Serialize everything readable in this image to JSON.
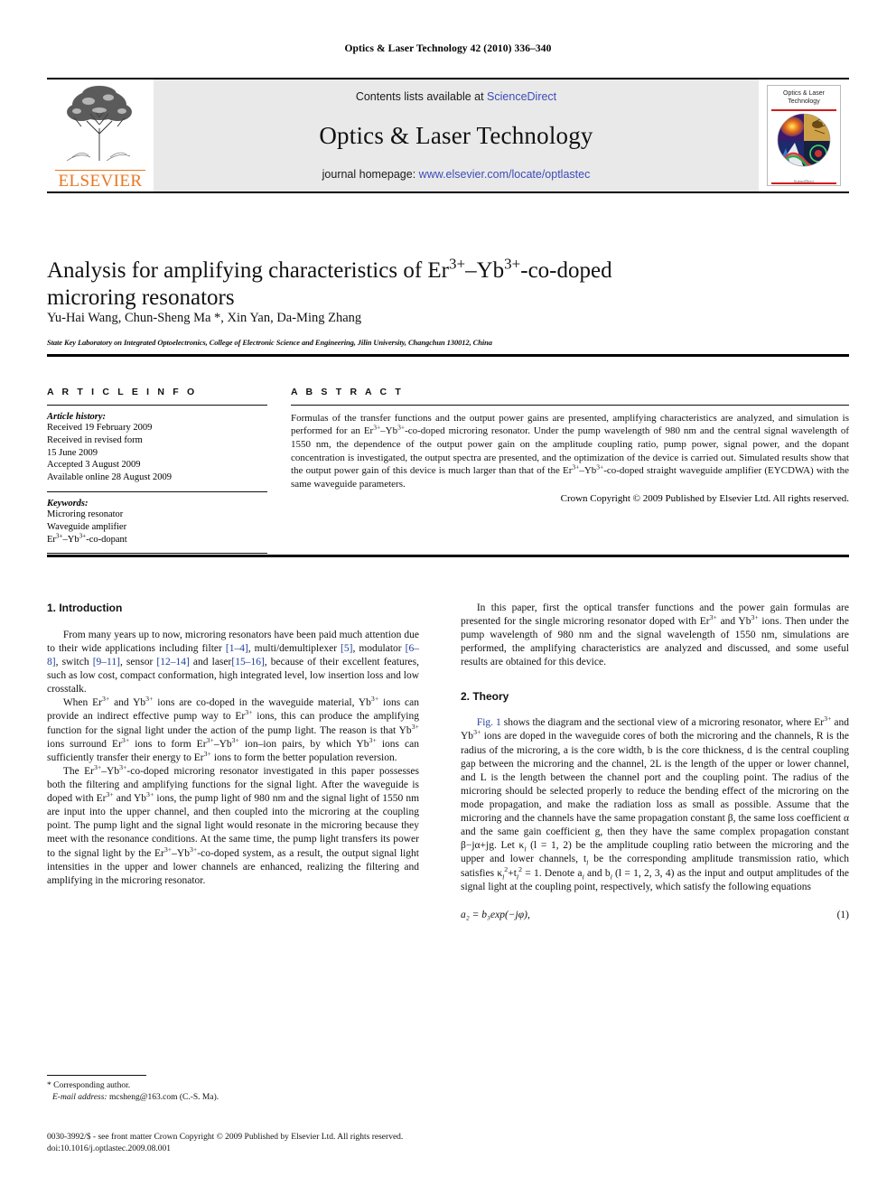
{
  "running_head": "Optics & Laser Technology 42 (2010) 336–340",
  "masthead": {
    "publisher": "ELSEVIER",
    "contents_prefix": "Contents lists available at ",
    "contents_link": "ScienceDirect",
    "journal_title": "Optics & Laser Technology",
    "homepage_prefix": "journal homepage: ",
    "homepage_url": "www.elsevier.com/locate/optlastec",
    "cover_title": "Optics & Laser Technology",
    "cover_footer": "ScienceDirect"
  },
  "article": {
    "title_line1_a": "Analysis for amplifying characteristics of Er",
    "title_sup1": "3+",
    "title_line1_b": "–Yb",
    "title_sup2": "3+",
    "title_line1_c": "-co-doped",
    "title_line2": "microring resonators",
    "authors": "Yu-Hai Wang, Chun-Sheng Ma *, Xin Yan, Da-Ming Zhang",
    "affiliation": "State Key Laboratory on Integrated Optoelectronics, College of Electronic Science and Engineering, Jilin University, Changchun 130012, China"
  },
  "article_info": {
    "heading": "A R T I C L E   I N F O",
    "history_label": "Article history:",
    "history": [
      "Received 19 February 2009",
      "Received in revised form",
      "15 June 2009",
      "Accepted 3 August 2009",
      "Available online 28 August 2009"
    ],
    "keywords_label": "Keywords:",
    "keywords": [
      "Microring resonator",
      "Waveguide amplifier"
    ],
    "keyword_codoped_a": "Er",
    "keyword_codoped_sup1": "3+",
    "keyword_codoped_b": "–Yb",
    "keyword_codoped_sup2": "3+",
    "keyword_codoped_c": "-co-dopant"
  },
  "abstract": {
    "heading": "A B S T R A C T",
    "p1": "Formulas of the transfer functions and the output power gains are presented, amplifying characteristics are analyzed, and simulation is performed for an Er",
    "p2": "–Yb",
    "p3": "-co-doped microring resonator. Under the pump wavelength of 980 nm and the central signal wavelength of 1550 nm, the dependence of the output power gain on the amplitude coupling ratio, pump power, signal power, and the dopant concentration is investigated, the output spectra are presented, and the optimization of the device is carried out. Simulated results show that the output power gain of this device is much larger than that of the Er",
    "p4": "–Yb",
    "p5": "-co-doped straight waveguide amplifier (EYCDWA) with the same waveguide parameters.",
    "sup": "3+",
    "copyright": "Crown Copyright © 2009 Published by Elsevier Ltd. All rights reserved."
  },
  "body": {
    "intro_heading": "1. Introduction",
    "intro_p1_a": "From many years up to now, microring resonators have been paid much attention due to their wide applications including filter ",
    "intro_ref1": "[1–4]",
    "intro_p1_b": ", multi/demultiplexer ",
    "intro_ref2": "[5]",
    "intro_p1_c": ", modulator ",
    "intro_ref3": "[6–8]",
    "intro_p1_d": ", switch ",
    "intro_ref4": "[9–11]",
    "intro_p1_e": ", sensor ",
    "intro_ref5": "[12–14]",
    "intro_p1_f": " and laser",
    "intro_ref6": "[15–16]",
    "intro_p1_g": ", because of their excellent features, such as low cost, compact conformation, high integrated level, low insertion loss and low crosstalk.",
    "intro_p2_a": "When Er",
    "intro_p2_b": " and Yb",
    "intro_p2_c": " ions are co-doped in the waveguide material, Yb",
    "intro_p2_d": " ions can provide an indirect effective pump way to Er",
    "intro_p2_e": " ions, this can produce the amplifying function for the signal light under the action of the pump light. The reason is that Yb",
    "intro_p2_f": " ions surround Er",
    "intro_p2_g": " ions to form Er",
    "intro_p2_h": "–Yb",
    "intro_p2_i": " ion–ion pairs, by which Yb",
    "intro_p2_j": " ions can sufficiently transfer their energy to Er",
    "intro_p2_k": " ions to form the better population reversion.",
    "intro_p3_a": "The Er",
    "intro_p3_b": "–Yb",
    "intro_p3_c": "-co-doped microring resonator investigated in this paper possesses both the filtering and amplifying functions for the signal light. After the waveguide is doped with Er",
    "intro_p3_d": " and Yb",
    "intro_p3_e": " ions, the pump light of 980 nm and the signal light of 1550 nm are input into the upper channel, and then coupled into the microring at the coupling point. The pump light and the signal light would resonate in the microring because they meet with the resonance conditions. At the same time, the pump light transfers its power to the signal light by the Er",
    "intro_p3_f": "–Yb",
    "intro_p3_g": "-co-doped system, as a result, the output signal light intensities in the upper and lower channels are enhanced, realizing the filtering and amplifying in the microring resonator.",
    "right_p1_a": "In this paper, first the optical transfer functions and the power gain formulas are presented for the single microring resonator doped with Er",
    "right_p1_b": " and Yb",
    "right_p1_c": " ions. Then under the pump wavelength of 980 nm and the signal wavelength of 1550 nm, simulations are performed, the amplifying characteristics are analyzed and discussed, and some useful results are obtained for this device.",
    "theory_heading": "2. Theory",
    "theory_fig_ref": "Fig. 1",
    "theory_p1_a": " shows the diagram and the sectional view of a microring resonator, where Er",
    "theory_p1_b": " and Yb",
    "theory_p1_c": " ions are doped in the waveguide cores of both the microring and the channels, R is the radius of the microring, a is the core width, b is the core thickness, d is the central coupling gap between the microring and the channel, 2L is the length of the upper or lower channel, and L is the length between the channel port and the coupling point. The radius of the microring should be selected properly to reduce the bending effect of the microring on the mode propagation, and make the radiation loss as small as possible. Assume that the microring and the channels have the same propagation constant β, the same loss coefficient α and the same gain coefficient g, then they have the same complex propagation constant β−jα+jg. Let κ",
    "theory_p1_d": " (l = 1, 2) be the amplitude coupling ratio between the microring and the upper and lower channels, t",
    "theory_p1_e": " be the corresponding amplitude transmission ratio, which satisfies κ",
    "theory_p1_f": "+t",
    "theory_p1_g": " = 1. Denote a",
    "theory_p1_h": " and b",
    "theory_p1_i": " (l = 1, 2, 3, 4) as the input and output amplitudes of the signal light at the coupling point, respectively, which satisfy the following equations",
    "sup3": "3+",
    "equation_1": "a₂ = b₃exp(−jφ),",
    "equation_1_num": "(1)"
  },
  "footnotes": {
    "corresponding": "* Corresponding author.",
    "email_label": "E-mail address:",
    "email": " mcsheng@163.com (C.-S. Ma).",
    "imprint_line1": "0030-3992/$ - see front matter Crown Copyright © 2009 Published by Elsevier Ltd. All rights reserved.",
    "imprint_line2": "doi:10.1016/j.optlastec.2009.08.001"
  },
  "colors": {
    "link": "#20409a",
    "elsevier_orange": "#E87722",
    "masthead_gray": "#e9e9e9",
    "cover_red": "#d01c1c"
  }
}
